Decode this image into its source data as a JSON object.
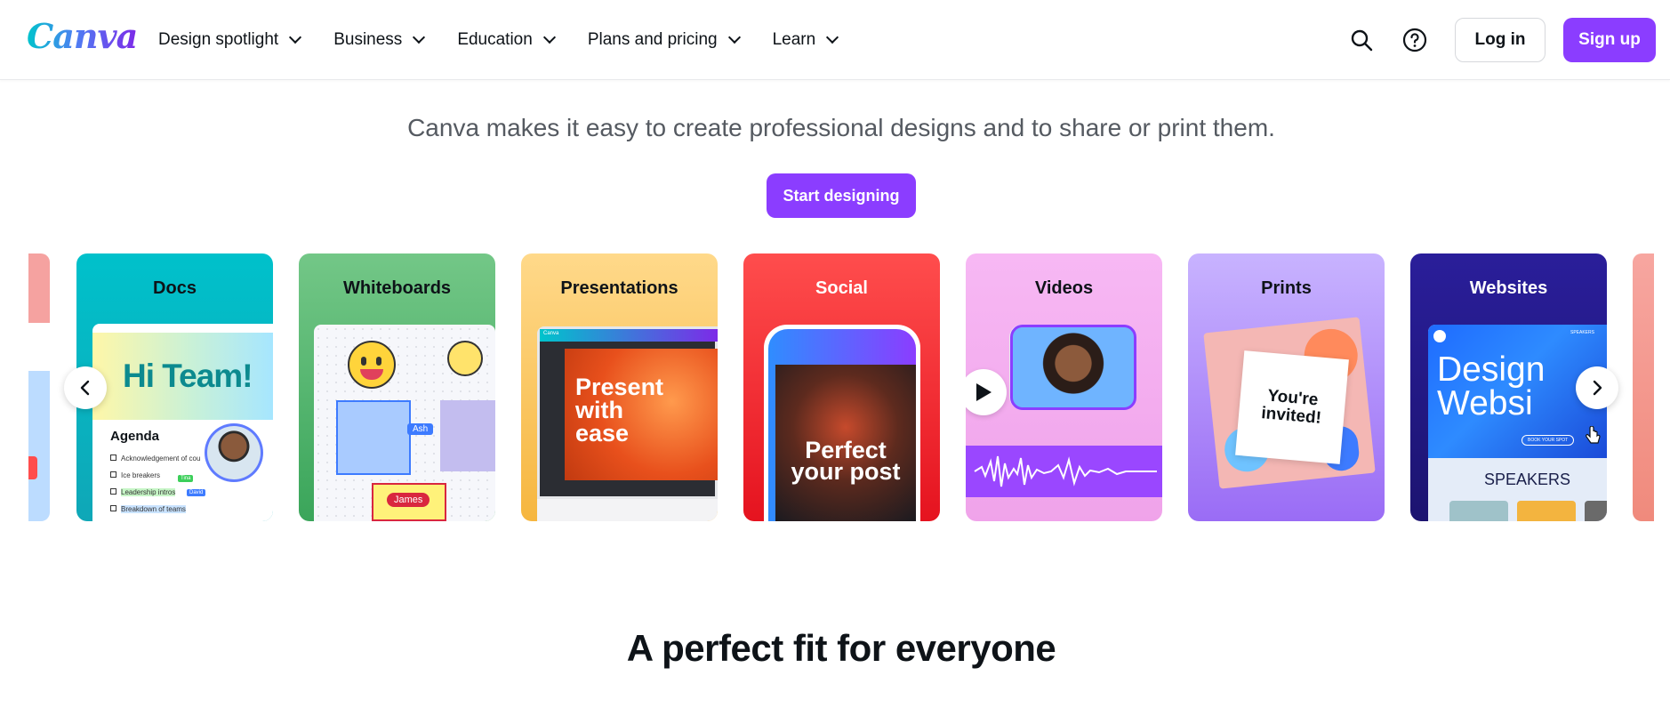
{
  "header": {
    "logo": "Canva",
    "nav": [
      {
        "label": "Design spotlight"
      },
      {
        "label": "Business"
      },
      {
        "label": "Education"
      },
      {
        "label": "Plans and pricing"
      },
      {
        "label": "Learn"
      }
    ],
    "icons": [
      "search-icon",
      "help-icon"
    ],
    "login_label": "Log in",
    "signup_label": "Sign up"
  },
  "hero": {
    "subtitle": "Canva makes it easy to create professional designs and to share or print them.",
    "cta_label": "Start designing"
  },
  "carousel": {
    "cards": [
      {
        "label": "Docs",
        "preview_title": "Hi Team!",
        "agenda_title": "Agenda",
        "agenda_items": [
          "Acknowledgement of cou",
          "Ice breakers",
          "Leadership intros",
          "Breakdown of teams"
        ],
        "tags": [
          "Tina",
          "David"
        ]
      },
      {
        "label": "Whiteboards",
        "tags": [
          "Ash",
          "James"
        ]
      },
      {
        "label": "Presentations",
        "preview_text": "Present with ease",
        "app_label": "Canva"
      },
      {
        "label": "Social",
        "preview_text": "Perfect your post"
      },
      {
        "label": "Videos"
      },
      {
        "label": "Prints",
        "preview_text": "You're invited!"
      },
      {
        "label": "Websites",
        "preview_text": "Design Websi",
        "speakers_label": "SPEAKERS",
        "nav_text": "SPEAKERS",
        "button_text": "BOOK YOUR SPOT"
      }
    ],
    "prev_icon": "chevron-left-icon",
    "next_icon": "chevron-right-icon"
  },
  "section": {
    "heading": "A perfect fit for everyone"
  },
  "colors": {
    "brand_purple": "#8b3dff",
    "text_dark": "#0e1318"
  }
}
